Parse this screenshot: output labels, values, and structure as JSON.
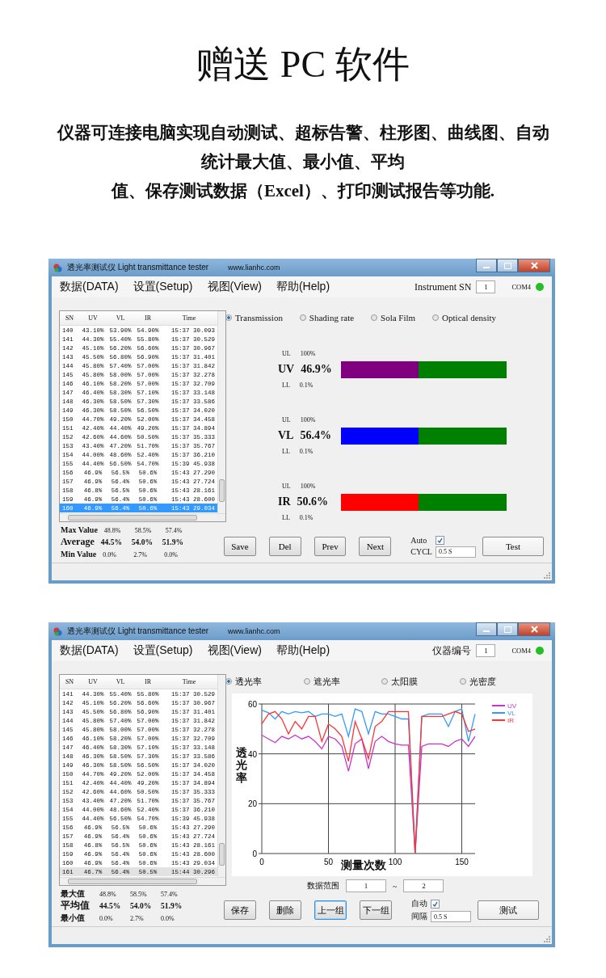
{
  "heading": "赠送 PC 软件",
  "intro_lines": [
    "仪器可连接电脑实现自动测试、超标告警、柱形图、曲线图、自动",
    "统计最大值、最小值、平均",
    "值、保存测试数据（Excel）、打印测试报告等功能."
  ],
  "windows": [
    {
      "title": "透光率测试仪 Light transmittance tester",
      "website": "www.lianhc.com",
      "menu": [
        "数据(DATA)",
        "设置(Setup)",
        "视图(View)",
        "帮助(Help)"
      ],
      "instrument_label": "Instrument SN",
      "instrument_value": "1",
      "port": "COM4",
      "connected": true,
      "table": {
        "focused": true,
        "columns": [
          "SN",
          "UV",
          "VL",
          "IR",
          "Time"
        ],
        "rows": [
          {
            "cells": [
              "140",
              "43.10%",
              "53.90%",
              "54.90%",
              "15:37 30.093"
            ],
            "selected": false
          },
          {
            "cells": [
              "141",
              "44.30%",
              "55.40%",
              "55.80%",
              "15:37 30.529"
            ],
            "selected": false
          },
          {
            "cells": [
              "142",
              "45.10%",
              "56.20%",
              "56.60%",
              "15:37 30.967"
            ],
            "selected": false
          },
          {
            "cells": [
              "143",
              "45.50%",
              "56.80%",
              "56.90%",
              "15:37 31.401"
            ],
            "selected": false
          },
          {
            "cells": [
              "144",
              "45.80%",
              "57.40%",
              "57.00%",
              "15:37 31.842"
            ],
            "selected": false
          },
          {
            "cells": [
              "145",
              "45.80%",
              "58.00%",
              "57.00%",
              "15:37 32.278"
            ],
            "selected": false
          },
          {
            "cells": [
              "146",
              "46.10%",
              "58.20%",
              "57.00%",
              "15:37 32.709"
            ],
            "selected": false
          },
          {
            "cells": [
              "147",
              "46.40%",
              "58.30%",
              "57.10%",
              "15:37 33.148"
            ],
            "selected": false
          },
          {
            "cells": [
              "148",
              "46.30%",
              "58.50%",
              "57.30%",
              "15:37 33.586"
            ],
            "selected": false
          },
          {
            "cells": [
              "149",
              "46.30%",
              "58.50%",
              "56.50%",
              "15:37 34.020"
            ],
            "selected": false
          },
          {
            "cells": [
              "150",
              "44.70%",
              "49.20%",
              "52.00%",
              "15:37 34.458"
            ],
            "selected": false
          },
          {
            "cells": [
              "151",
              "42.40%",
              "44.40%",
              "49.20%",
              "15:37 34.894"
            ],
            "selected": false
          },
          {
            "cells": [
              "152",
              "42.60%",
              "44.60%",
              "50.50%",
              "15:37 35.333"
            ],
            "selected": false
          },
          {
            "cells": [
              "153",
              "43.40%",
              "47.20%",
              "51.70%",
              "15:37 35.767"
            ],
            "selected": false
          },
          {
            "cells": [
              "154",
              "44.00%",
              "48.60%",
              "52.40%",
              "15:37 36.210"
            ],
            "selected": false
          },
          {
            "cells": [
              "155",
              "44.40%",
              "56.50%",
              "54.70%",
              "15:39 45.938"
            ],
            "selected": false
          },
          {
            "cells": [
              "156",
              "46.9%",
              "56.5%",
              "50.6%",
              "15:43 27.290"
            ],
            "selected": false
          },
          {
            "cells": [
              "157",
              "46.9%",
              "56.4%",
              "50.6%",
              "15:43 27.724"
            ],
            "selected": false
          },
          {
            "cells": [
              "158",
              "46.8%",
              "56.5%",
              "50.6%",
              "15:43 28.161"
            ],
            "selected": false
          },
          {
            "cells": [
              "159",
              "46.9%",
              "56.4%",
              "50.6%",
              "15:43 28.600"
            ],
            "selected": false
          },
          {
            "cells": [
              "160",
              "46.9%",
              "56.4%",
              "50.6%",
              "15:43 29.034"
            ],
            "selected": true
          }
        ]
      },
      "stats": [
        {
          "kind": "max",
          "label": "Max Value",
          "values": [
            "48.8%",
            "58.5%",
            "57.4%"
          ]
        },
        {
          "kind": "average",
          "label": "Average",
          "values": [
            "44.5%",
            "54.0%",
            "51.9%"
          ]
        },
        {
          "kind": "min",
          "label": "Min Value",
          "values": [
            "0.0%",
            "2.7%",
            "0.0%"
          ]
        }
      ],
      "modes": [
        {
          "label": "Transmission",
          "selected": true
        },
        {
          "label": "Shading rate",
          "selected": false
        },
        {
          "label": "Sola Film",
          "selected": false
        },
        {
          "label": "Optical density",
          "selected": false
        }
      ],
      "display": {
        "kind": "meters",
        "meters": [
          {
            "upper_label": "UL",
            "upper": "100%",
            "label": "UV",
            "value": "46.9%",
            "lower_label": "LL",
            "lower": "0.1%",
            "level": 0.47,
            "color": "#800080"
          },
          {
            "upper_label": "UL",
            "upper": "100%",
            "label": "VL",
            "value": "56.4%",
            "lower_label": "LL",
            "lower": "0.1%",
            "level": 0.47,
            "color": "#0000ff"
          },
          {
            "upper_label": "UL",
            "upper": "100%",
            "label": "IR",
            "value": "50.6%",
            "lower_label": "LL",
            "lower": "0.1%",
            "level": 0.47,
            "color": "#ff0000"
          }
        ]
      },
      "buttons": [
        {
          "label": "Save",
          "focused": false
        },
        {
          "label": "Del",
          "focused": false
        },
        {
          "label": "Prev",
          "focused": false
        },
        {
          "label": "Next",
          "focused": false
        }
      ],
      "auto": {
        "label": "Auto",
        "checked": true
      },
      "interval": {
        "label": "CYCL",
        "value": "0.5  S"
      },
      "test_button": "Test"
    },
    {
      "title": "透光率测试仪 Light transmittance tester",
      "website": "www.lianhc.com",
      "menu": [
        "数据(DATA)",
        "设置(Setup)",
        "视图(View)",
        "帮助(Help)"
      ],
      "instrument_label": "仪器编号",
      "instrument_value": "1",
      "port": "COM4",
      "connected": true,
      "table": {
        "focused": false,
        "columns": [
          "SN",
          "UV",
          "VL",
          "IR",
          "Time"
        ],
        "rows": [
          {
            "cells": [
              "141",
              "44.30%",
              "55.40%",
              "55.80%",
              "15:37 30.529"
            ],
            "selected": false
          },
          {
            "cells": [
              "142",
              "45.10%",
              "56.20%",
              "56.60%",
              "15:37 30.967"
            ],
            "selected": false
          },
          {
            "cells": [
              "143",
              "45.50%",
              "56.80%",
              "56.90%",
              "15:37 31.401"
            ],
            "selected": false
          },
          {
            "cells": [
              "144",
              "45.80%",
              "57.40%",
              "57.00%",
              "15:37 31.842"
            ],
            "selected": false
          },
          {
            "cells": [
              "145",
              "45.80%",
              "58.00%",
              "57.00%",
              "15:37 32.278"
            ],
            "selected": false
          },
          {
            "cells": [
              "146",
              "46.10%",
              "58.20%",
              "57.00%",
              "15:37 32.709"
            ],
            "selected": false
          },
          {
            "cells": [
              "147",
              "46.40%",
              "58.30%",
              "57.10%",
              "15:37 33.148"
            ],
            "selected": false
          },
          {
            "cells": [
              "148",
              "46.30%",
              "58.50%",
              "57.30%",
              "15:37 33.586"
            ],
            "selected": false
          },
          {
            "cells": [
              "149",
              "46.30%",
              "58.50%",
              "56.50%",
              "15:37 34.020"
            ],
            "selected": false
          },
          {
            "cells": [
              "150",
              "44.70%",
              "49.20%",
              "52.00%",
              "15:37 34.458"
            ],
            "selected": false
          },
          {
            "cells": [
              "151",
              "42.40%",
              "44.40%",
              "49.20%",
              "15:37 34.894"
            ],
            "selected": false
          },
          {
            "cells": [
              "152",
              "42.60%",
              "44.60%",
              "50.50%",
              "15:37 35.333"
            ],
            "selected": false
          },
          {
            "cells": [
              "153",
              "43.40%",
              "47.20%",
              "51.70%",
              "15:37 35.767"
            ],
            "selected": false
          },
          {
            "cells": [
              "154",
              "44.00%",
              "48.60%",
              "52.40%",
              "15:37 36.210"
            ],
            "selected": false
          },
          {
            "cells": [
              "155",
              "44.40%",
              "56.50%",
              "54.70%",
              "15:39 45.938"
            ],
            "selected": false
          },
          {
            "cells": [
              "156",
              "46.9%",
              "56.5%",
              "50.6%",
              "15:43 27.290"
            ],
            "selected": false
          },
          {
            "cells": [
              "157",
              "46.9%",
              "56.4%",
              "50.6%",
              "15:43 27.724"
            ],
            "selected": false
          },
          {
            "cells": [
              "158",
              "46.8%",
              "56.5%",
              "50.6%",
              "15:43 28.161"
            ],
            "selected": false
          },
          {
            "cells": [
              "159",
              "46.9%",
              "56.4%",
              "50.6%",
              "15:43 28.600"
            ],
            "selected": false
          },
          {
            "cells": [
              "160",
              "46.9%",
              "56.4%",
              "50.6%",
              "15:43 29.034"
            ],
            "selected": false
          },
          {
            "cells": [
              "161",
              "46.7%",
              "56.4%",
              "50.5%",
              "15:44 30.296"
            ],
            "selected": true
          }
        ]
      },
      "stats": [
        {
          "kind": "max",
          "label": "最大值",
          "values": [
            "48.8%",
            "58.5%",
            "57.4%"
          ]
        },
        {
          "kind": "average",
          "label": "平均值",
          "values": [
            "44.5%",
            "54.0%",
            "51.9%"
          ]
        },
        {
          "kind": "min",
          "label": "最小值",
          "values": [
            "0.0%",
            "2.7%",
            "0.0%"
          ]
        }
      ],
      "modes": [
        {
          "label": "透光率",
          "selected": true
        },
        {
          "label": "遮光率",
          "selected": false
        },
        {
          "label": "太阳膜",
          "selected": false
        },
        {
          "label": "光密度",
          "selected": false
        }
      ],
      "display": {
        "kind": "chart",
        "range": {
          "label": "数据范围",
          "from": "1",
          "separator": "~",
          "to": "2"
        },
        "chart_data": {
          "type": "line",
          "xlabel": "测量次数",
          "ylabel": "透光率",
          "x": [
            0,
            5,
            10,
            15,
            20,
            25,
            30,
            35,
            40,
            45,
            50,
            55,
            60,
            65,
            70,
            75,
            80,
            85,
            90,
            95,
            100,
            105,
            110,
            115,
            120,
            125,
            130,
            135,
            140,
            145,
            150,
            155,
            160
          ],
          "xlim": [
            0,
            160
          ],
          "ylim": [
            0,
            60
          ],
          "xticks": [
            0,
            50,
            100,
            150
          ],
          "yticks": [
            0,
            20,
            40,
            60
          ],
          "grid": true,
          "legend": true,
          "series": [
            {
              "name": "UV",
              "color": "#cc33cc",
              "values": [
                47.5,
                46,
                44.5,
                47,
                46,
                47.5,
                46,
                47,
                45,
                42,
                47,
                46,
                43,
                33,
                44,
                46,
                34,
                45,
                47,
                45,
                44,
                43.5,
                43.5,
                0,
                43,
                44,
                44,
                44,
                43,
                45,
                46,
                43,
                47
              ]
            },
            {
              "name": "VL",
              "color": "#3399ff",
              "values": [
                57.5,
                56.5,
                54,
                57,
                56,
                57,
                56.5,
                57,
                55,
                56,
                56,
                55,
                56,
                47,
                58,
                57,
                48,
                57,
                56,
                56,
                55,
                54,
                54,
                0,
                55,
                56,
                56,
                56,
                51,
                57,
                58,
                45,
                56
              ]
            },
            {
              "name": "IR",
              "color": "#ff3333",
              "values": [
                52,
                56,
                57,
                54,
                48,
                53,
                50,
                55,
                55,
                45,
                52,
                50,
                47,
                37,
                53,
                46,
                38,
                51,
                53,
                57,
                57,
                57,
                57,
                0,
                55,
                55,
                55,
                55,
                56,
                57,
                56,
                49,
                50
              ]
            }
          ]
        }
      },
      "buttons": [
        {
          "label": "保存",
          "focused": false
        },
        {
          "label": "删除",
          "focused": false
        },
        {
          "label": "上一组",
          "focused": true
        },
        {
          "label": "下一组",
          "focused": false
        }
      ],
      "auto": {
        "label": "自动",
        "checked": true
      },
      "interval": {
        "label": "间隔",
        "value": "0.5  S"
      },
      "test_button": "测试"
    }
  ]
}
